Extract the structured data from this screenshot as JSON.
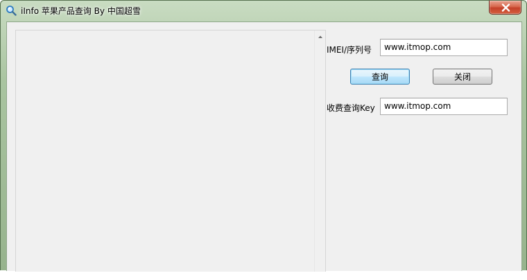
{
  "window": {
    "title": "iInfo 苹果产品查询 By 中国超雪",
    "app_icon": "magnifier-icon",
    "close_icon": "close-icon"
  },
  "form": {
    "imei_label": "IMEI/序列号",
    "imei_value": "www.itmop.com",
    "query_button": "查询",
    "close_button": "关闭",
    "key_label": "收费查询Key",
    "key_value": "www.itmop.com"
  },
  "output": {
    "text": ""
  },
  "colors": {
    "titlebar": "#a9c4a0",
    "close_button": "#c4412a",
    "client_bg": "#f0f0f0",
    "focused_button": "#bee6fd"
  }
}
